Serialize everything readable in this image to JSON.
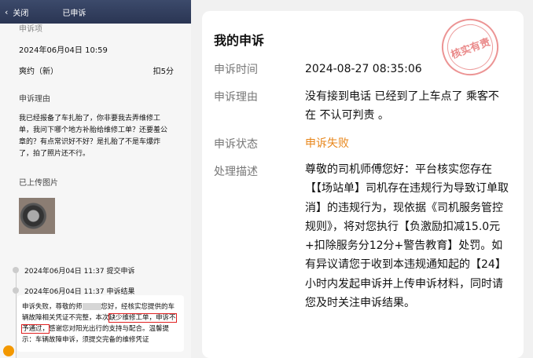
{
  "left": {
    "nav": {
      "back": "关闭",
      "title": "已申诉"
    },
    "faded_header": "申诉项",
    "time": "2024年06月04日 10:59",
    "violation": {
      "name": "爽约（新）",
      "points": "扣5分"
    },
    "reason_title": "申诉理由",
    "reason_text": "我已经报备了车扎胎了，你非要我去弄维修工单，我问下哪个地方补胎给维修工单？还要羞公章的？有点常识好不好？是扎胎了不是车爆炸了，拍了照片还不行。",
    "images_title": "已上传图片",
    "timeline": [
      "2024年06月04日 11:37 提交申诉",
      "2024年06月04日 11:37 申诉结果"
    ],
    "result": {
      "p1": "申诉失败，尊敬的师",
      "p2": "您好，经核实您提供的车辆故障相关凭证不完整，本次",
      "highlight": "缺少维修工单，申诉不予通过，",
      "p3": "感谢您对阳光出行的支持与配合。温馨提示：车辆故障申诉，须提交完备的维修凭证"
    }
  },
  "right": {
    "title": "我的申诉",
    "stamp": "核实有责",
    "fields": [
      {
        "label": "申诉时间",
        "value": "2024-08-27 08:35:06"
      },
      {
        "label": "申诉理由",
        "value": "没有接到电话 已经到了上车点了 乘客不在 不认可判责 。"
      },
      {
        "label": "申诉状态",
        "value": "申诉失败"
      },
      {
        "label": "处理描述",
        "value": "尊敬的司机师傅您好：平台核实您存在【【场站单】司机存在违规行为导致订单取消】的违规行为，现依据《司机服务管控规则》，将对您执行【负激励扣减15.0元+扣除服务分12分+警告教育】处罚。如有异议请您于收到本违规通知起的【24】小时内发起申诉并上传申诉材料，同时请您及时关注申诉结果。"
      }
    ]
  }
}
